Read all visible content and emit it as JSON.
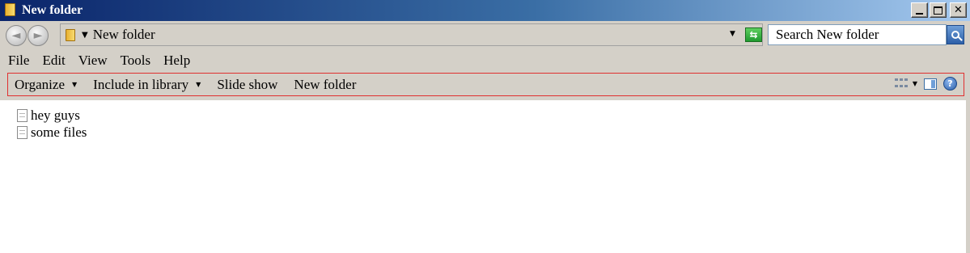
{
  "window": {
    "title": "New folder",
    "controls": {
      "minimize": "minimize",
      "maximize": "maximize",
      "close": "✕"
    }
  },
  "address": {
    "back_glyph": "◄",
    "forward_glyph": "►",
    "crumb_arrow": "▼",
    "path": "New folder",
    "dropdown_glyph": "▼",
    "refresh_glyph": "⇆"
  },
  "search": {
    "placeholder": "Search New folder"
  },
  "menu": {
    "items": [
      {
        "label": "File"
      },
      {
        "label": "Edit"
      },
      {
        "label": "View"
      },
      {
        "label": "Tools"
      },
      {
        "label": "Help"
      }
    ]
  },
  "commandbar": {
    "organize": "Organize",
    "include_in_library": "Include in library",
    "slide_show": "Slide show",
    "new_folder": "New folder",
    "caret": "▼",
    "help_glyph": "?"
  },
  "files": [
    {
      "name": "hey guys",
      "icon": "text-file-icon"
    },
    {
      "name": "some files",
      "icon": "text-file-icon"
    }
  ],
  "colors": {
    "titlebar_start": "#0a246a",
    "titlebar_end": "#a6caf0",
    "commandbar_border": "#e03030",
    "chrome": "#d4d0c8"
  }
}
